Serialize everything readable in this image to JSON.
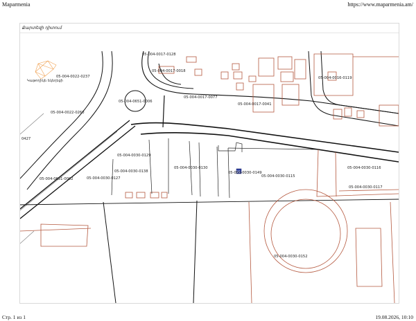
{
  "page_header": {
    "site_name": "Maparmenia",
    "url": "https://www.maparmenia.am/"
  },
  "page_footer": {
    "page_number": "Стр. 1 из 1",
    "datetime": "19.08.2026, 10:10"
  },
  "map_panel": {
    "title": "Քարտեզի դիտում"
  },
  "map": {
    "colors": {
      "road_line": "#111111",
      "parcel_line": "#b4583e",
      "orange_triangle": "#f0a050",
      "marker": "#2c3e9e"
    },
    "landmark_label": "Կաթողիկե եկեղեցի",
    "marker_label": "25",
    "parcel_labels": [
      "05-004-0017-0128",
      "05-004-0017-0018",
      "05-004-0022-0237",
      "05-004-0016-0119",
      "05-004-0017-0077",
      "05-004-0651-0006",
      "05-004-0017-0041",
      "05-004-0022-0260",
      "0427",
      "05-004-0030-0129",
      "05-004-0030-0138",
      "05-004-0030-0130",
      "05-004-0030-0149",
      "05-004-0030-0115",
      "05-004-0030-0116",
      "05-004-0651-0002",
      "05-004-0030-0127",
      "05-004-0030-0117",
      "05-004-0030-0152"
    ]
  }
}
